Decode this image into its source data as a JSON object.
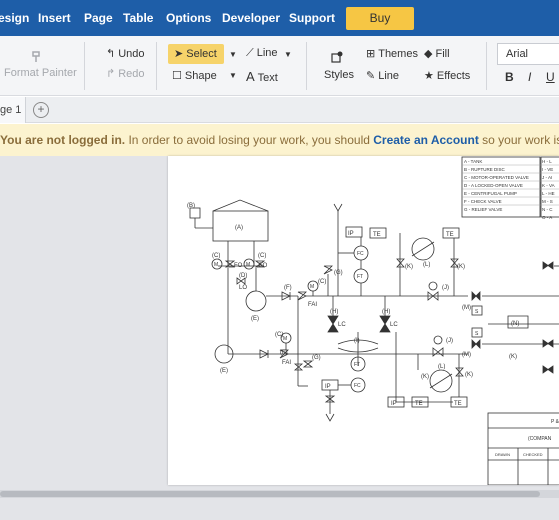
{
  "menu": {
    "items": [
      "esign",
      "Insert",
      "Page",
      "Table",
      "Options",
      "Developer",
      "Support"
    ],
    "buy_label": "Buy"
  },
  "toolbar": {
    "format_painter": "Format Painter",
    "undo": "Undo",
    "redo": "Redo",
    "select": "Select",
    "shape": "Shape",
    "line": "Line",
    "text": "Text",
    "styles": "Styles",
    "themes": "Themes",
    "fill": "Fill",
    "line_style": "Line",
    "effects": "Effects",
    "font": "Arial",
    "bold": "B",
    "italic": "I",
    "underline": "U"
  },
  "pages": {
    "tab_label": "ge 1",
    "add_label": "+"
  },
  "notice": {
    "bold": "You are not logged in.",
    "text": " In order to avoid losing your work, you should ",
    "link": "Create an Account",
    "tail": " so your work is saved p"
  },
  "diagram": {
    "legend_left": [
      "A - TANK",
      "B - RUPTURE DISC",
      "C - MOTOR-OPERATED VALVE",
      "D - A LOCKED-OPEN VALVE",
      "E - CENTRIFUGAL PUMP",
      "F - CHECK VALVE",
      "G - RELIEF VALVE"
    ],
    "legend_right": [
      "H - L",
      "I - VE",
      "J - AI",
      "K - VA",
      "L - HE",
      "M - S",
      "N - C",
      "O - A"
    ],
    "labels": {
      "a": "(A)",
      "b": "(B)",
      "c": "(C)",
      "d": "(D)",
      "e": "(E)",
      "f": "(F)",
      "g": "(G)",
      "h": "(H)",
      "i": "(I)",
      "j": "(J)",
      "k": "(K)",
      "l": "(L)",
      "m": "(M)",
      "n": "(N)",
      "fo": "FO",
      "lo": "LO",
      "fai": "FAI",
      "lc": "LC",
      "ip": "IP",
      "te": "TE",
      "fc": "FC",
      "ft": "FT",
      "m_letter": "M",
      "s_letter": "S"
    },
    "title_block": {
      "top": "P &",
      "company": "(COMPAN",
      "drawn": "DRAWN",
      "checked": "CHECKED"
    }
  }
}
